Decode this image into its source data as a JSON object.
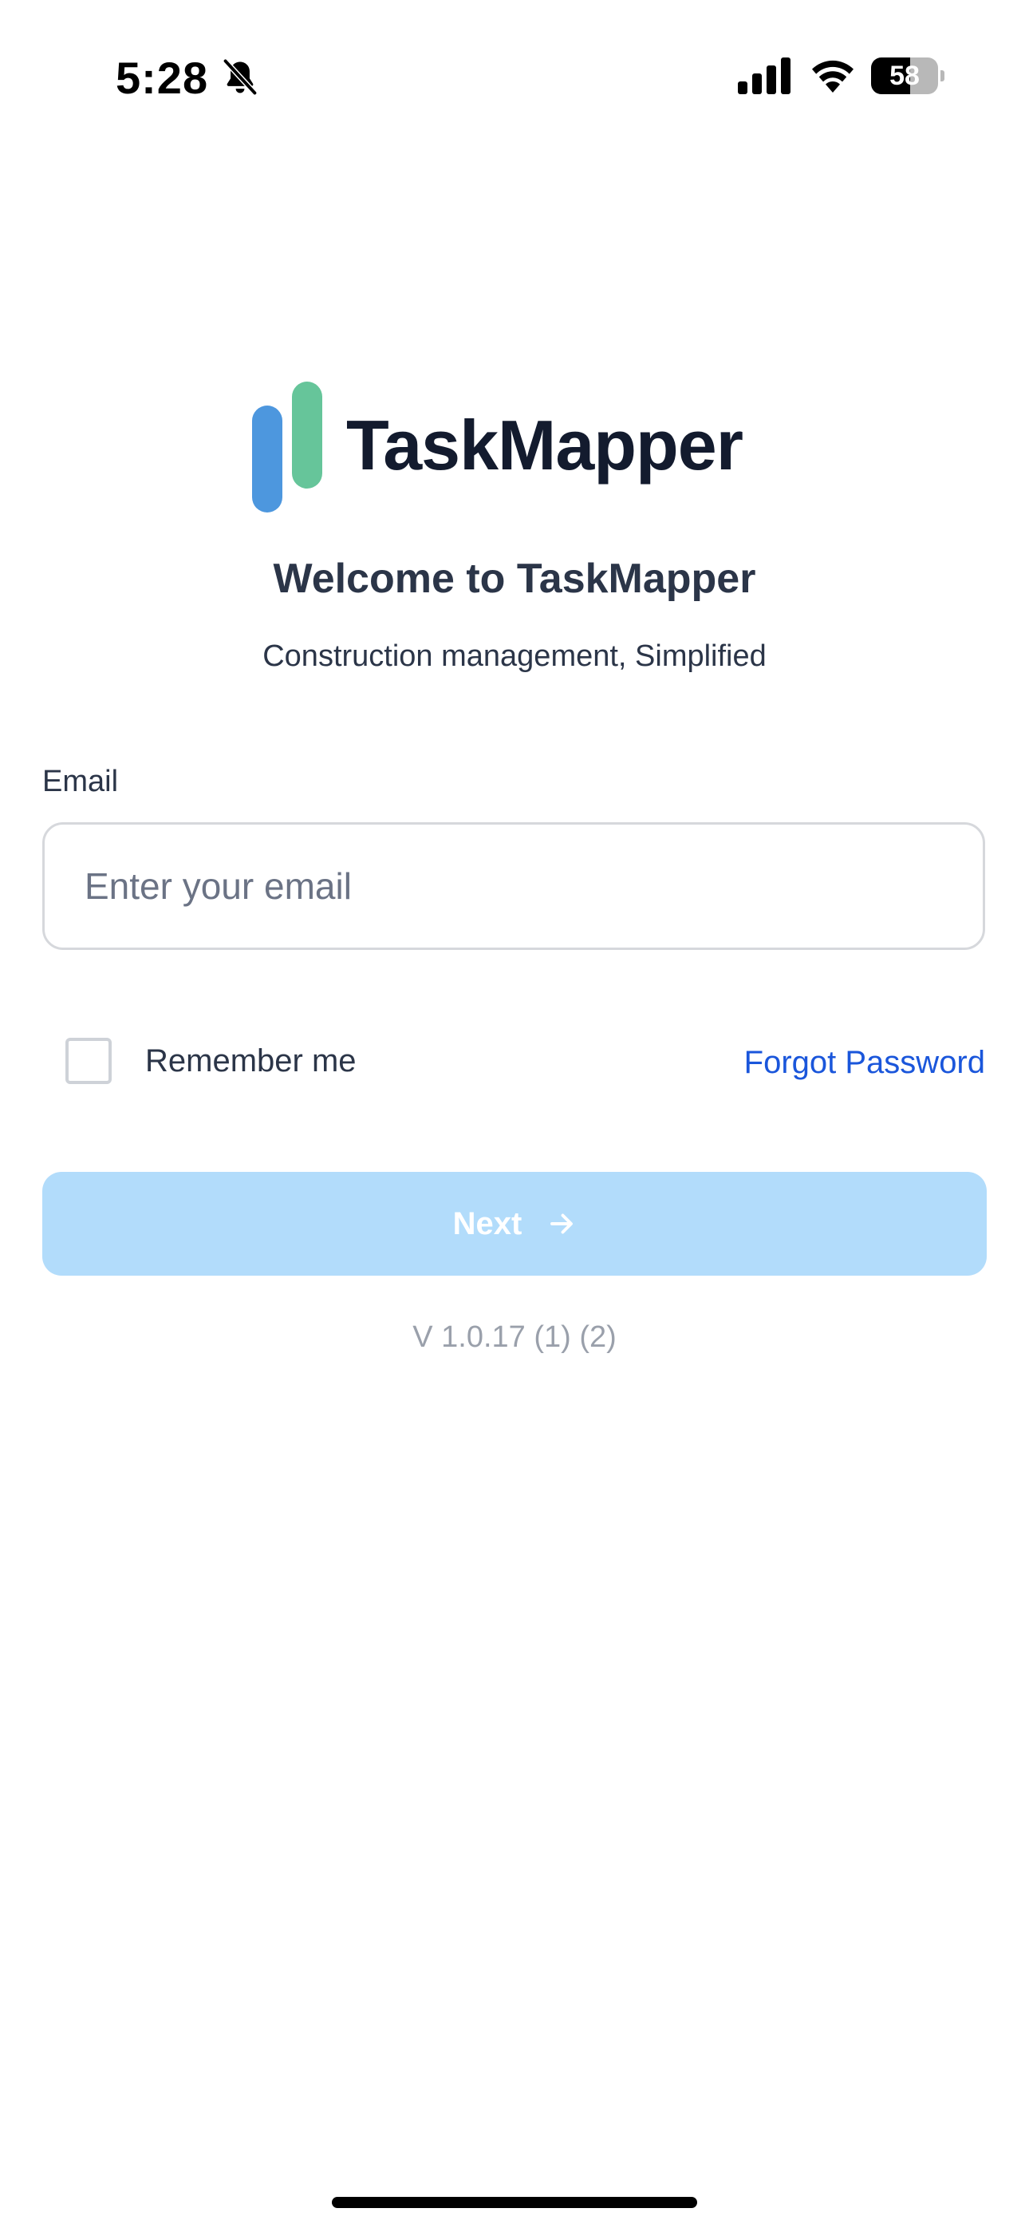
{
  "status_bar": {
    "time": "5:28",
    "battery_percent": "58",
    "icons": [
      "bell-slash-icon",
      "cellular-signal-icon",
      "wifi-icon",
      "battery-icon"
    ]
  },
  "logo": {
    "text": "TaskMapper",
    "colors": {
      "blue": "#4d97de",
      "green": "#66c59a",
      "text": "#131b2e"
    }
  },
  "welcome": {
    "title": "Welcome to TaskMapper",
    "tagline": "Construction management, Simplified"
  },
  "form": {
    "email_label": "Email",
    "email_placeholder": "Enter your email",
    "email_value": "",
    "remember_label": "Remember me",
    "remember_checked": false,
    "forgot_label": "Forgot Password",
    "next_label": "Next",
    "next_icon": "arrow-right-icon",
    "next_enabled": false
  },
  "version": "V 1.0.17 (1) (2)",
  "colors": {
    "accent_link": "#1a56db",
    "button_disabled": "#b2dcfb",
    "text_primary": "#2b3548",
    "text_muted": "#9aa0ab"
  }
}
